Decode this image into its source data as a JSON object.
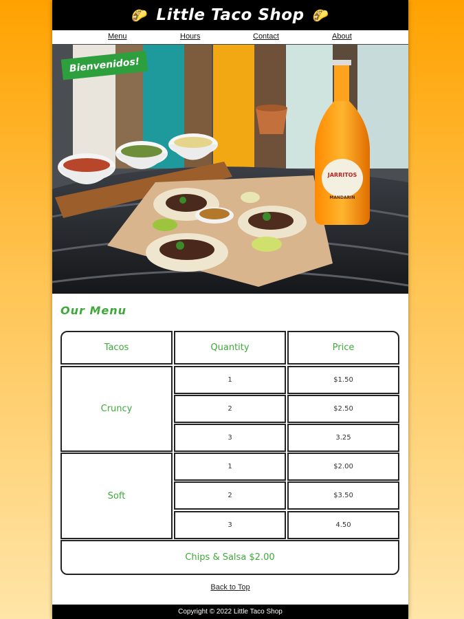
{
  "header": {
    "title": "Little Taco Shop",
    "left_emoji": "🌮",
    "right_emoji": "🌮"
  },
  "nav": {
    "items": [
      "Menu",
      "Hours",
      "Contact",
      "About"
    ]
  },
  "hero": {
    "banner": "Bienvenidos!",
    "bottle_brand": "JARRITOS",
    "bottle_flavor": "MANDARIN"
  },
  "menu": {
    "title": "Our Menu",
    "headers": [
      "Tacos",
      "Quantity",
      "Price"
    ],
    "groups": [
      {
        "type": "Cruncy",
        "rows": [
          {
            "qty": "1",
            "price": "$1.50"
          },
          {
            "qty": "2",
            "price": "$2.50"
          },
          {
            "qty": "3",
            "price": "3.25"
          }
        ]
      },
      {
        "type": "Soft",
        "rows": [
          {
            "qty": "1",
            "price": "$2.00"
          },
          {
            "qty": "2",
            "price": "$3.50"
          },
          {
            "qty": "3",
            "price": "4.50"
          }
        ]
      }
    ],
    "extra": "Chips & Salsa $2.00"
  },
  "back_to_top": "Back to Top",
  "footer": "Copyright © 2022 Little Taco Shop",
  "colors": {
    "accent_green": "#3ea93a",
    "banner_green": "#2e9f3d",
    "bg_orange": "#ffa200"
  }
}
